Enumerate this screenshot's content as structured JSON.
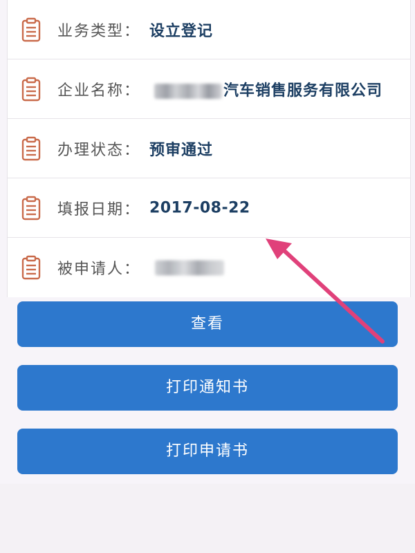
{
  "details": {
    "rows": [
      {
        "label": "业务类型：",
        "value": "设立登记"
      },
      {
        "label": "企业名称：",
        "value": "汽车销售服务有限公司"
      },
      {
        "label": "办理状态：",
        "value": "预审通过"
      },
      {
        "label": "填报日期：",
        "value": "2017-08-22"
      },
      {
        "label": "被申请人：",
        "value": ""
      }
    ]
  },
  "actions": {
    "view": "查看",
    "print_notice": "打印通知书",
    "print_application": "打印申请书"
  },
  "colors": {
    "accent": "#2d78cd",
    "icon": "#c96a4a",
    "value_text": "#1d3f63",
    "annotation_arrow": "#e0417a"
  },
  "icons": {
    "row_icon": "clipboard-icon"
  }
}
